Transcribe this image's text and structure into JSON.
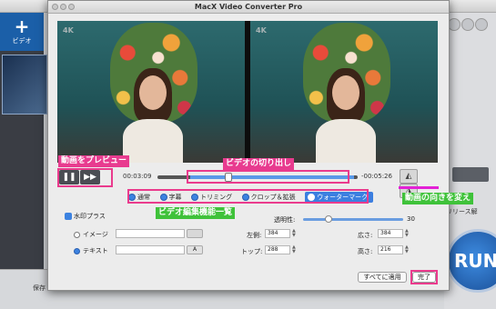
{
  "background_app": {
    "add_video_label": "ビデオ",
    "release_label": "リリース解",
    "save_label": "保存",
    "run_label": "RUN"
  },
  "dialog": {
    "title": "MacX Video Converter Pro",
    "video_badge": "4K",
    "time_start": "00:03:09",
    "time_end": "-00:05:26",
    "tabs": [
      {
        "label": "通常",
        "active": false
      },
      {
        "label": "字幕",
        "active": false
      },
      {
        "label": "トリミング",
        "active": false
      },
      {
        "label": "クロップ＆拡張",
        "active": false
      },
      {
        "label": "ウォーターマーク",
        "active": true
      }
    ],
    "watermark_checkbox": "水印プラス",
    "opacity_label": "透明性:",
    "opacity_value": "30",
    "image_option": "イメージ",
    "text_option": "テキスト",
    "font_button": "A",
    "left_label": "左側:",
    "left_value": "384",
    "top_label": "トップ:",
    "top_value": "288",
    "width_label": "広さ:",
    "width_value": "384",
    "height_label": "高さ:",
    "height_value": "216",
    "apply_all_button": "すべてに適用",
    "done_button": "完了"
  },
  "annotations": {
    "preview": "動画をプレビュー",
    "cut": "ビデオの切り出し",
    "rotate": "動画の向きを変え",
    "edit_features": "ビデオ編集機能一覧"
  },
  "colors": {
    "annotation_pink": "#e83b8f",
    "annotation_green": "#3fc23a",
    "accent_blue": "#3b7fe0"
  }
}
